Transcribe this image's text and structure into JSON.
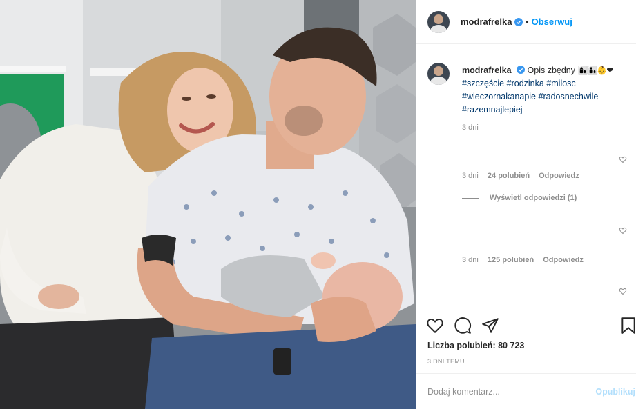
{
  "post": {
    "username": "modrafrelka",
    "follow_label": "Obserwuj",
    "dot": "•"
  },
  "caption": {
    "username": "modrafrelka",
    "text": "Opis zbędny",
    "emoji": "👩‍👦👨‍👦👶❤",
    "tags": [
      "#szczęście",
      "#rodzinka",
      "#milosc",
      "#wieczornakanapie",
      "#radosnechwile",
      "#razemnajlepiej"
    ],
    "age": "3 dni"
  },
  "comments": [
    {
      "age": "3 dni",
      "likes": "24 polubień",
      "reply_label": "Odpowiedz"
    },
    {
      "age": "3 dni",
      "likes": "125 polubień",
      "reply_label": "Odpowiedz"
    }
  ],
  "view_replies": "Wyświetl odpowiedzi (1)",
  "likes_total": "Liczba polubień: 80 723",
  "posted": "3 DNI TEMU",
  "add_comment": {
    "placeholder": "Dodaj komentarz...",
    "post_label": "Opublikuj"
  },
  "colors": {
    "link": "#0095f6",
    "hashtag": "#00376b",
    "muted": "#8e8e8e",
    "post_disabled": "#b2dffc"
  },
  "icons": [
    "verified-badge-icon",
    "heart-icon",
    "comment-icon",
    "share-icon",
    "bookmark-icon"
  ]
}
